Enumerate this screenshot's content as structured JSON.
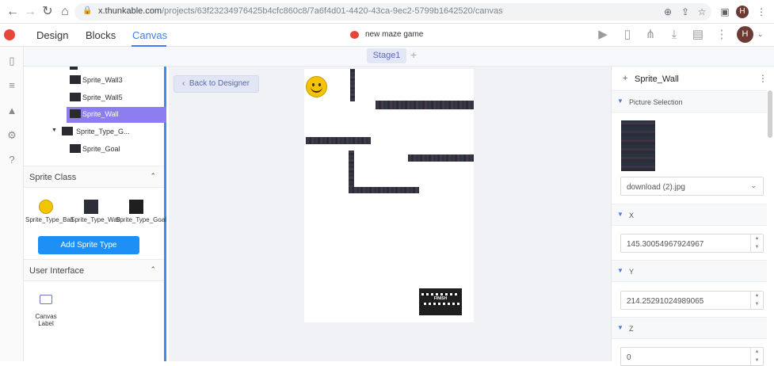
{
  "browser": {
    "url_host": "x.thunkable.com",
    "url_path": "/projects/63f23234976425b4cfc860c8/7a6f4d01-4420-43ca-9ec2-5799b1642520/canvas",
    "avatar_letter": "H"
  },
  "header": {
    "tabs": [
      {
        "label": "Design"
      },
      {
        "label": "Blocks"
      },
      {
        "label": "Canvas",
        "active": true
      }
    ],
    "project_name": "new maze game",
    "avatar_letter": "H",
    "accent_color": "#3f7ee8"
  },
  "stage_bar": {
    "tab_label": "Stage1",
    "add_label": "+"
  },
  "tree": {
    "items": [
      {
        "label": "Sprite_Wall3"
      },
      {
        "label": "Sprite_Wall5"
      },
      {
        "label": "Sprite_Wall",
        "selected": true
      },
      {
        "label": "Sprite_Type_G...",
        "group": true
      },
      {
        "label": "Sprite_Goal"
      }
    ]
  },
  "sprite_class": {
    "title": "Sprite Class",
    "types": [
      {
        "label": "Sprite_Type_Ball",
        "icon": "smiley-icon"
      },
      {
        "label": "Sprite_Type_Wall",
        "icon": "wall-icon"
      },
      {
        "label": "Sprite_Type_Goal",
        "icon": "finish-icon"
      }
    ],
    "add_button": "Add Sprite Type"
  },
  "user_interface": {
    "title": "User Interface",
    "component_label": "Canvas\nLabel"
  },
  "canvas": {
    "back_button": "Back to Designer",
    "goal_text": "FINISH"
  },
  "properties": {
    "title": "Sprite_Wall",
    "sections": {
      "picture": "Picture Selection",
      "x": "X",
      "y": "Y",
      "z": "Z"
    },
    "picture_value": "download (2).jpg",
    "x_value": "145.30054967924967",
    "y_value": "214.25291024989065",
    "z_value": "0"
  }
}
